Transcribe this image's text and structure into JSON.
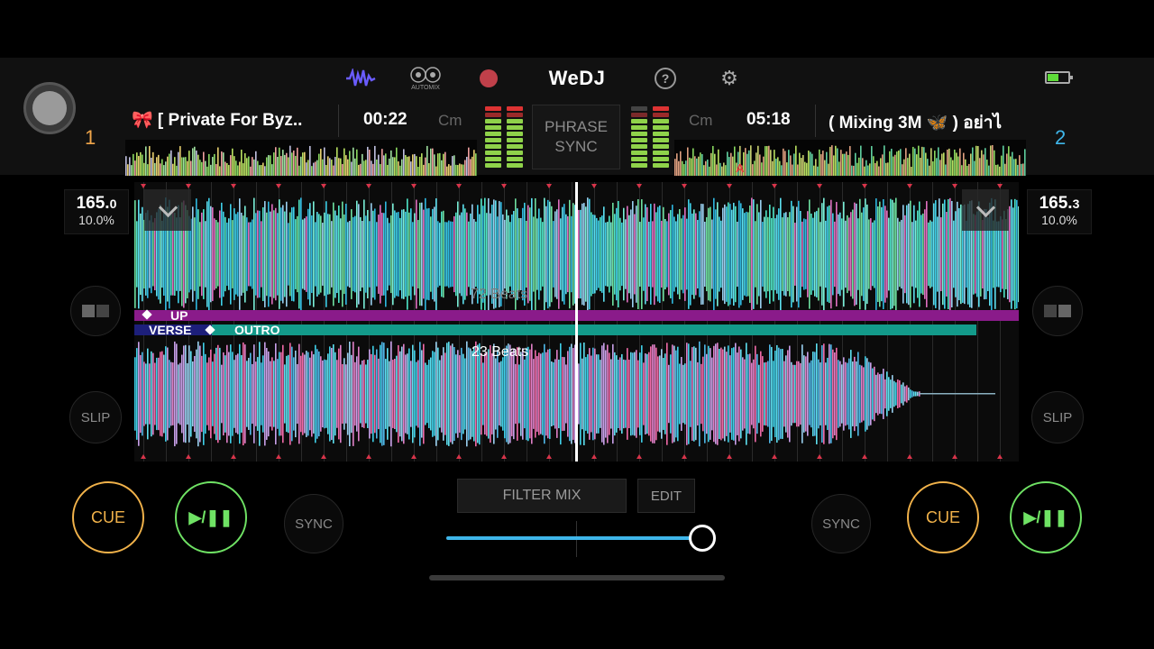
{
  "header": {
    "brand": "WeDJ",
    "automix_label": "AUTOMIX",
    "icons": [
      "waveform-icon",
      "automix-icon",
      "record-icon",
      "help-icon",
      "settings-icon",
      "battery-icon"
    ],
    "phrase_sync": "PHRASE\nSYNC"
  },
  "deck1": {
    "number": "1",
    "title": "🎀 [ Private For Byz..",
    "time": "00:22",
    "key": "Cm",
    "bpm_int": "165.",
    "bpm_dec": "0",
    "pitch": "10.0%",
    "slip": "SLIP",
    "cue": "CUE",
    "play": "▶/❚❚",
    "sync": "SYNC",
    "beats_label": "72 Beats",
    "phrase_label": "UP",
    "color": "#f0a64a"
  },
  "deck2": {
    "number": "2",
    "title": "( Mixing 3M 🦋 ) อย่าไ",
    "time": "05:18",
    "key": "Cm",
    "bpm_int": "165.",
    "bpm_dec": "3",
    "pitch": "10.0%",
    "slip": "SLIP",
    "cue": "CUE",
    "play": "▶/❚❚",
    "sync": "SYNC",
    "beats_label": "23 Beats",
    "phrase_verse": "VERSE",
    "phrase_outro": "OUTRO",
    "cue_marker": "A",
    "color": "#3fb6ea"
  },
  "mixer": {
    "filter_mix": "FILTER MIX",
    "edit": "EDIT",
    "crossfader_position": 1.0
  },
  "colors": {
    "cue": "#f1b24a",
    "play": "#6fe264",
    "crossfader": "#3fb6ea",
    "phrase_up": "#8a1b8a",
    "phrase_outro": "#139a8a",
    "record": "#c0404a",
    "waveform_icon": "#6a5cff"
  }
}
